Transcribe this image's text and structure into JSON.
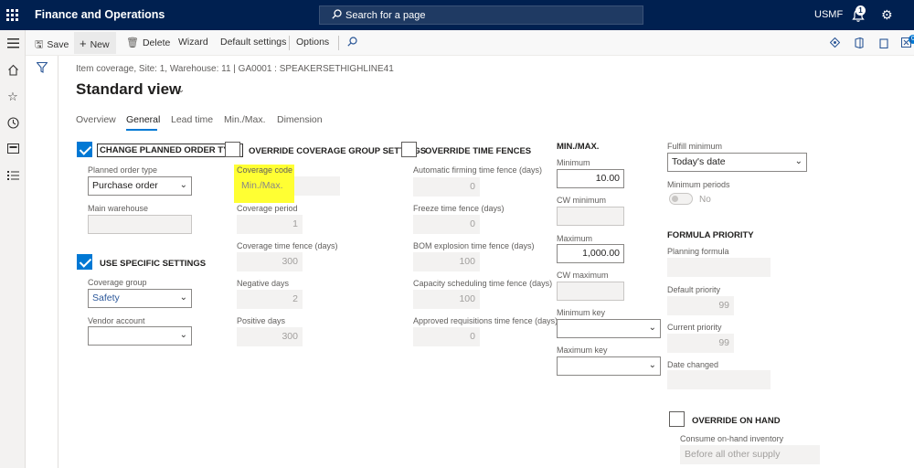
{
  "topbar": {
    "app_title": "Finance and Operations",
    "search_placeholder": "Search for a page",
    "company": "USMF",
    "notification_count": "1"
  },
  "actions": {
    "save": "Save",
    "new": "New",
    "delete": "Delete",
    "wizard": "Wizard",
    "default_settings": "Default settings",
    "options": "Options",
    "attachments_count": "0"
  },
  "page": {
    "breadcrumb": "Item coverage, Site: 1, Warehouse: 11   |   GA0001 : SPEAKERSETHIGHLINE41",
    "view_title": "Standard view"
  },
  "tabs": [
    "Overview",
    "General",
    "Lead time",
    "Min./Max.",
    "Dimension"
  ],
  "col1": {
    "change_planned_order_type": "CHANGE PLANNED ORDER TYPE",
    "planned_order_type_label": "Planned order type",
    "planned_order_type_value": "Purchase order",
    "main_warehouse_label": "Main warehouse",
    "main_warehouse_value": "",
    "use_specific_settings": "USE SPECIFIC SETTINGS",
    "coverage_group_label": "Coverage group",
    "coverage_group_value": "Safety",
    "vendor_account_label": "Vendor account",
    "vendor_account_value": ""
  },
  "col2": {
    "override_coverage_group": "OVERRIDE COVERAGE GROUP SETTINGS",
    "coverage_code_label": "Coverage code",
    "coverage_code_value": "Min./Max.",
    "coverage_period_label": "Coverage period",
    "coverage_period_value": "1",
    "coverage_time_fence_label": "Coverage time fence (days)",
    "coverage_time_fence_value": "300",
    "negative_days_label": "Negative days",
    "negative_days_value": "2",
    "positive_days_label": "Positive days",
    "positive_days_value": "300"
  },
  "col3": {
    "override_time_fences": "OVERRIDE TIME FENCES",
    "auto_firming_label": "Automatic firming time fence (days)",
    "auto_firming_value": "0",
    "freeze_label": "Freeze time fence (days)",
    "freeze_value": "0",
    "bom_label": "BOM explosion time fence (days)",
    "bom_value": "100",
    "capacity_label": "Capacity scheduling time fence (days)",
    "capacity_value": "100",
    "approved_req_label": "Approved requisitions time fence (days)",
    "approved_req_value": "0"
  },
  "col4": {
    "heading": "MIN./MAX.",
    "minimum_label": "Minimum",
    "minimum_value": "10.00",
    "cw_minimum_label": "CW minimum",
    "cw_minimum_value": "",
    "maximum_label": "Maximum",
    "maximum_value": "1,000.00",
    "cw_maximum_label": "CW maximum",
    "cw_maximum_value": "",
    "minimum_key_label": "Minimum key",
    "minimum_key_value": "",
    "maximum_key_label": "Maximum key",
    "maximum_key_value": ""
  },
  "col5": {
    "fulfill_minimum_label": "Fulfill minimum",
    "fulfill_minimum_value": "Today's date",
    "minimum_periods_label": "Minimum periods",
    "minimum_periods_toggle": "No",
    "formula_priority_heading": "FORMULA PRIORITY",
    "planning_formula_label": "Planning formula",
    "planning_formula_value": "",
    "default_priority_label": "Default priority",
    "default_priority_value": "99",
    "current_priority_label": "Current priority",
    "current_priority_value": "99",
    "date_changed_label": "Date changed",
    "date_changed_value": "",
    "override_on_hand": "OVERRIDE ON HAND",
    "consume_on_hand_label": "Consume on-hand inventory",
    "consume_on_hand_value": "Before all other supply"
  },
  "colors": {
    "topbar": "#002050",
    "accent": "#0078d4",
    "highlight": "#ffff33"
  }
}
